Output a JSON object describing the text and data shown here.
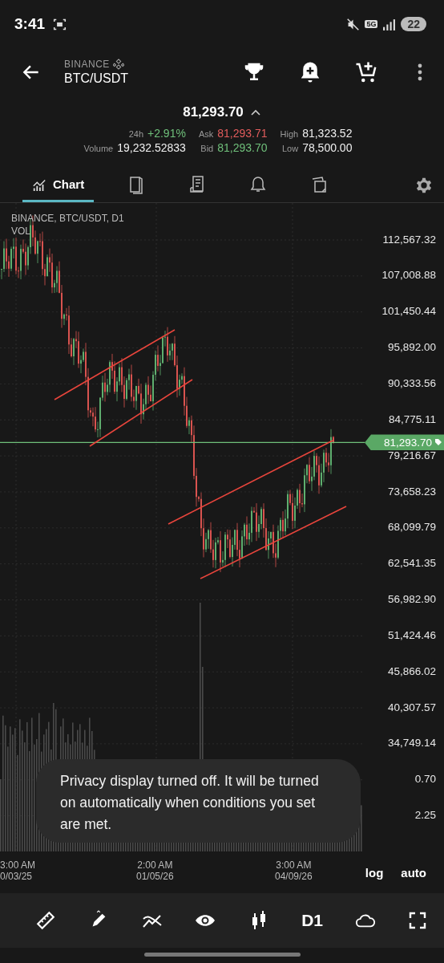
{
  "status_bar": {
    "time": "3:41",
    "network": "5G",
    "battery": "22"
  },
  "header": {
    "exchange": "BINANCE",
    "pair": "BTC/USDT"
  },
  "ticker": {
    "price": "81,293.70",
    "stats": [
      {
        "label": "24h",
        "value": "+2.91%",
        "color": "#6fbf7a"
      },
      {
        "label": "Ask",
        "value": "81,293.71",
        "color": "#e25c5c"
      },
      {
        "label": "High",
        "value": "81,323.52",
        "color": "#f0f0f0"
      },
      {
        "label": "Volume",
        "value": "19,232.52833",
        "color": "#f0f0f0"
      },
      {
        "label": "Bid",
        "value": "81,293.70",
        "color": "#6fbf7a"
      },
      {
        "label": "Low",
        "value": "78,500.00",
        "color": "#f0f0f0"
      }
    ]
  },
  "tabs": [
    {
      "label": "Chart",
      "selected": true
    },
    {
      "selected": false
    },
    {
      "selected": false
    },
    {
      "selected": false
    },
    {
      "selected": false
    }
  ],
  "chart": {
    "legend": "BINANCE, BTC/USDT, D1",
    "indicator": "VOL",
    "last_price": "81,293.70",
    "price_axis": [
      "112,567.32",
      "107,008.88",
      "101,450.44",
      "95,892.00",
      "90,333.56",
      "84,775.11",
      "79,216.67",
      "73,658.23",
      "68,099.79",
      "62,541.35",
      "56,982.90",
      "51,424.46",
      "45,866.02",
      "40,307.57",
      "34,749.14",
      "0.70",
      "2.25"
    ],
    "time_axis": [
      {
        "time": "3:00 AM",
        "date": "0/03/25"
      },
      {
        "time": "2:00 AM",
        "date": "01/05/26"
      },
      {
        "time": "3:00 AM",
        "date": "04/09/26"
      }
    ],
    "scale_modes": [
      "log",
      "auto"
    ]
  },
  "toast": "Privacy display turned off. It will be turned on automatically when conditions you set are met.",
  "toolbar": {
    "timeframe": "D1"
  }
}
